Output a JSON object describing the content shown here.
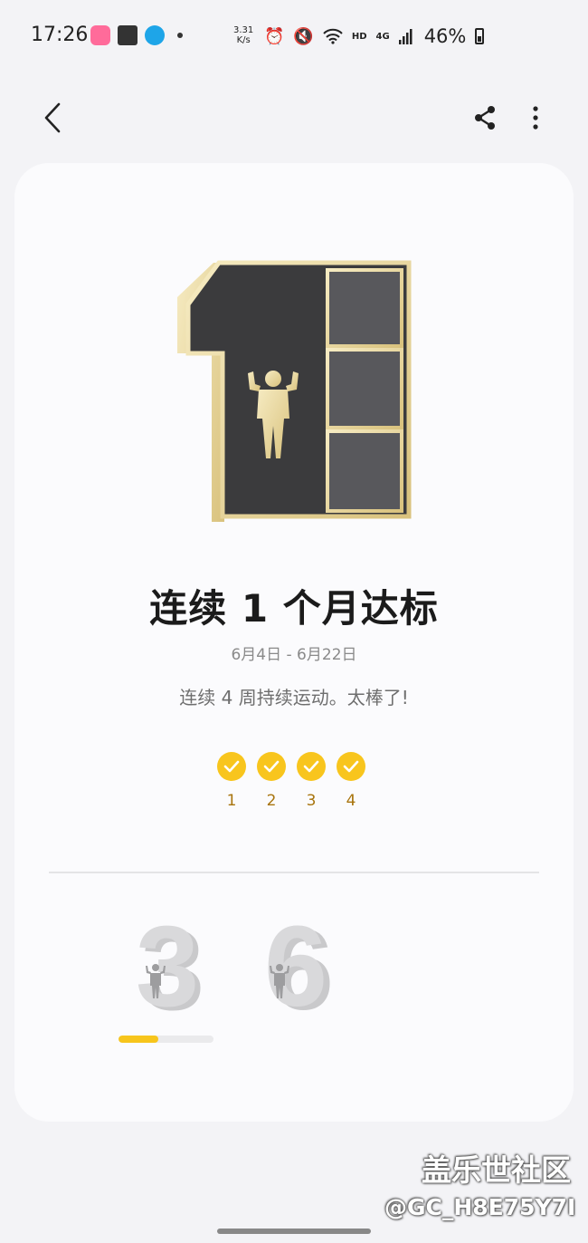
{
  "status_bar": {
    "time": "17:26",
    "net_speed_value": "3.31",
    "net_speed_unit": "K/s",
    "hd_label": "HD",
    "network_label": "4G",
    "battery_percent": "46%",
    "icons": [
      "bilibili-app-icon",
      "gallery-icon",
      "qq-icon",
      "alarm-icon",
      "mute-icon",
      "wifi-icon",
      "signal-icon",
      "battery-icon"
    ]
  },
  "toolbar": {
    "icons": [
      "back-arrow-icon",
      "share-icon",
      "more-vertical-icon"
    ]
  },
  "achievement": {
    "title": "连续 1 个月达标",
    "date_range": "6月4日 - 6月22日",
    "description": "连续 4 周持续运动。太棒了!",
    "weeks": [
      {
        "label": "1",
        "completed": true
      },
      {
        "label": "2",
        "completed": true
      },
      {
        "label": "3",
        "completed": true
      },
      {
        "label": "4",
        "completed": true
      }
    ]
  },
  "next_badges": [
    {
      "number": "3",
      "progress": 0.42
    },
    {
      "number": "6"
    }
  ],
  "colors": {
    "accent": "#f8c51d",
    "week_label": "#a8740d",
    "badge_dark": "#3b3b3d",
    "badge_gold": "#e8d9a0"
  },
  "watermark": {
    "line1": "盖乐世社区",
    "line2": "@GC_H8E75Y7I"
  }
}
